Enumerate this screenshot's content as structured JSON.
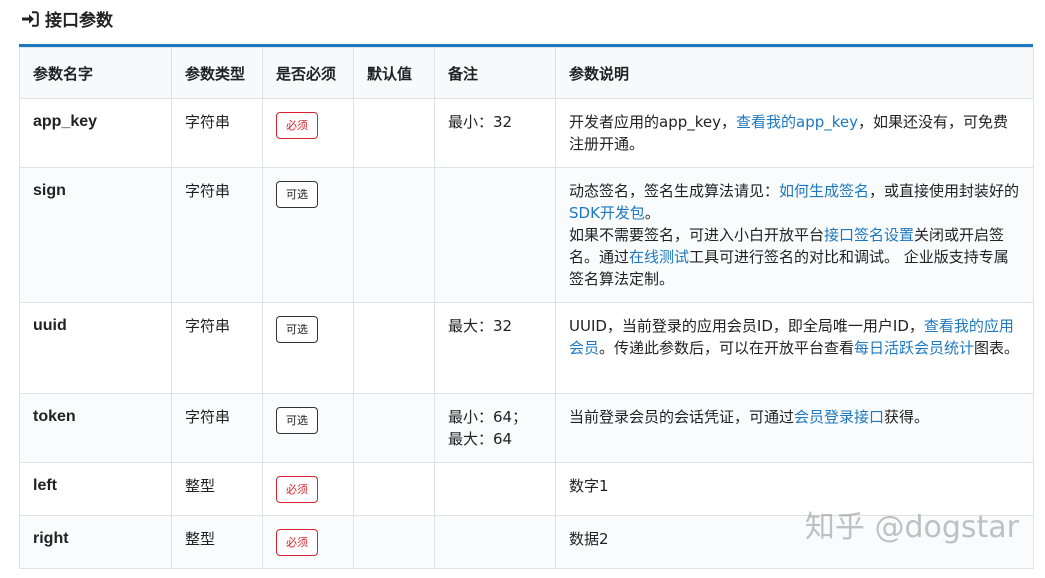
{
  "section": {
    "title": "接口参数",
    "icon": "sign-in-arrow-icon"
  },
  "table": {
    "headers": [
      "参数名字",
      "参数类型",
      "是否必须",
      "默认值",
      "备注",
      "参数说明"
    ],
    "rows": [
      {
        "name": "app_key",
        "type": "字符串",
        "required": {
          "label": "必须",
          "kind": "required"
        },
        "default": "",
        "remark": [
          "最小：32"
        ],
        "desc": [
          {
            "t": "开发者应用的app_key，"
          },
          {
            "t": "查看我的app_key",
            "link": true
          },
          {
            "t": "，如果还没有，可免费注册开通。"
          }
        ]
      },
      {
        "name": "sign",
        "type": "字符串",
        "required": {
          "label": "可选",
          "kind": "optional"
        },
        "default": "",
        "remark": [],
        "desc": [
          {
            "t": "动态签名，签名生成算法请见："
          },
          {
            "t": "如何生成签名",
            "link": true
          },
          {
            "t": "，或直接使用封装好的"
          },
          {
            "t": "SDK开发包",
            "link": true
          },
          {
            "t": "。"
          },
          {
            "br": true
          },
          {
            "t": "如果不需要签名，可进入小白开放平台"
          },
          {
            "t": "接口签名设置",
            "link": true
          },
          {
            "t": "关闭或开启签名。通过"
          },
          {
            "t": "在线测试",
            "link": true
          },
          {
            "t": "工具可进行签名的对比和调试。 企业版支持专属签名算法定制。"
          }
        ]
      },
      {
        "name": "uuid",
        "type": "字符串",
        "required": {
          "label": "可选",
          "kind": "optional"
        },
        "default": "",
        "remark": [
          "最大：32"
        ],
        "desc": [
          {
            "t": "UUID，当前登录的应用会员ID，即全局唯一用户ID，"
          },
          {
            "t": "查看我的应用会员",
            "link": true
          },
          {
            "t": "。传递此参数后，可以在开放平台查看"
          },
          {
            "t": "每日活跃会员统计",
            "link": true
          },
          {
            "t": "图表。"
          }
        ]
      },
      {
        "name": "token",
        "type": "字符串",
        "required": {
          "label": "可选",
          "kind": "optional"
        },
        "default": "",
        "remark": [
          "最小：64；",
          "最大：64"
        ],
        "desc": [
          {
            "t": "当前登录会员的会话凭证，可通过"
          },
          {
            "t": "会员登录接口",
            "link": true
          },
          {
            "t": "获得。"
          }
        ]
      },
      {
        "name": "left",
        "type": "整型",
        "required": {
          "label": "必须",
          "kind": "required"
        },
        "default": "",
        "remark": [],
        "desc": [
          {
            "t": "数字1"
          }
        ]
      },
      {
        "name": "right",
        "type": "整型",
        "required": {
          "label": "必须",
          "kind": "required"
        },
        "default": "",
        "remark": [],
        "desc": [
          {
            "t": "数据2"
          }
        ]
      }
    ]
  },
  "watermark": "知乎 @dogstar",
  "colors": {
    "accent": "#1d78c1",
    "required": "#d9232e",
    "border": "#dfe3e8",
    "header_bg": "#f7f9fb"
  }
}
